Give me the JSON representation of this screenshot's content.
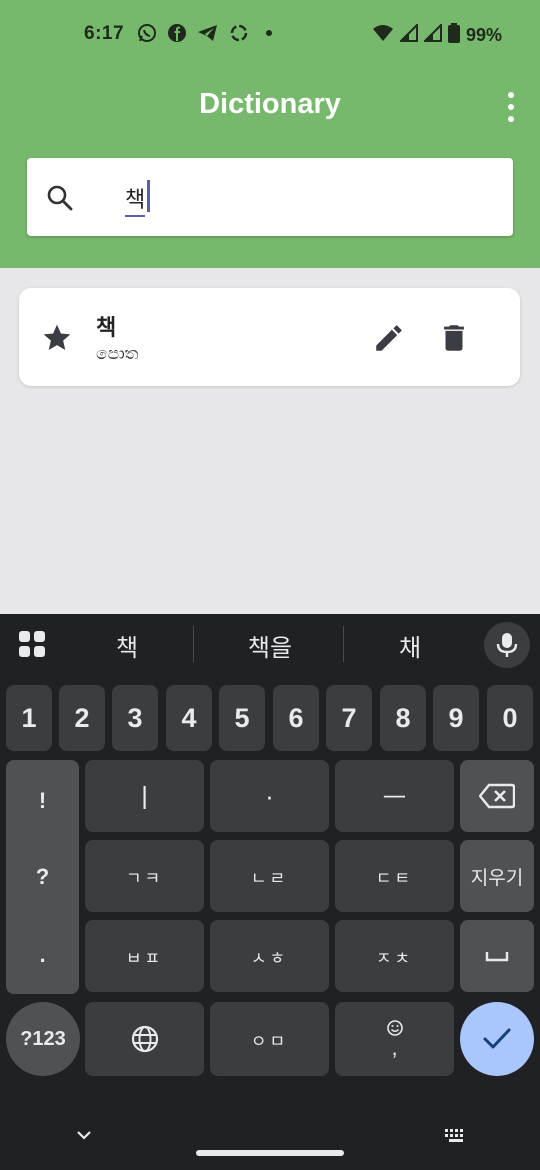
{
  "status_bar": {
    "time": "6:17",
    "battery": "99%",
    "left_icons": [
      "whatsapp-icon",
      "facebook-icon",
      "telegram-icon",
      "recycle-icon",
      "dot-icon"
    ],
    "right_icons": [
      "wifi-icon",
      "signal-icon",
      "signal-icon",
      "battery-icon"
    ]
  },
  "app_bar": {
    "title": "Dictionary",
    "menu_icon": "overflow-menu-icon",
    "color": "#77b96c"
  },
  "search": {
    "value": "책",
    "icon": "search-icon"
  },
  "entries": [
    {
      "word": "책",
      "translation": "පොත",
      "favorite": true,
      "actions": [
        "edit-icon",
        "delete-icon"
      ]
    }
  ],
  "keyboard": {
    "suggestions": [
      "책",
      "책을",
      "채"
    ],
    "number_row": [
      "1",
      "2",
      "3",
      "4",
      "5",
      "6",
      "7",
      "8",
      "9",
      "0"
    ],
    "punctuation": [
      "!",
      "?",
      "."
    ],
    "row1": [
      "ㅣ",
      "·",
      "ㅡ"
    ],
    "row2": [
      "ㄱㅋ",
      "ㄴㄹ",
      "ㄷㅌ"
    ],
    "row2_func": "지우기",
    "row3": [
      "ㅂㅍ",
      "ㅅㅎ",
      "ㅈㅊ"
    ],
    "row4_center": "ㅇㅁ",
    "row4_comma": ",",
    "symbols_label": "?123",
    "enter_color": "#a9c7fa"
  }
}
